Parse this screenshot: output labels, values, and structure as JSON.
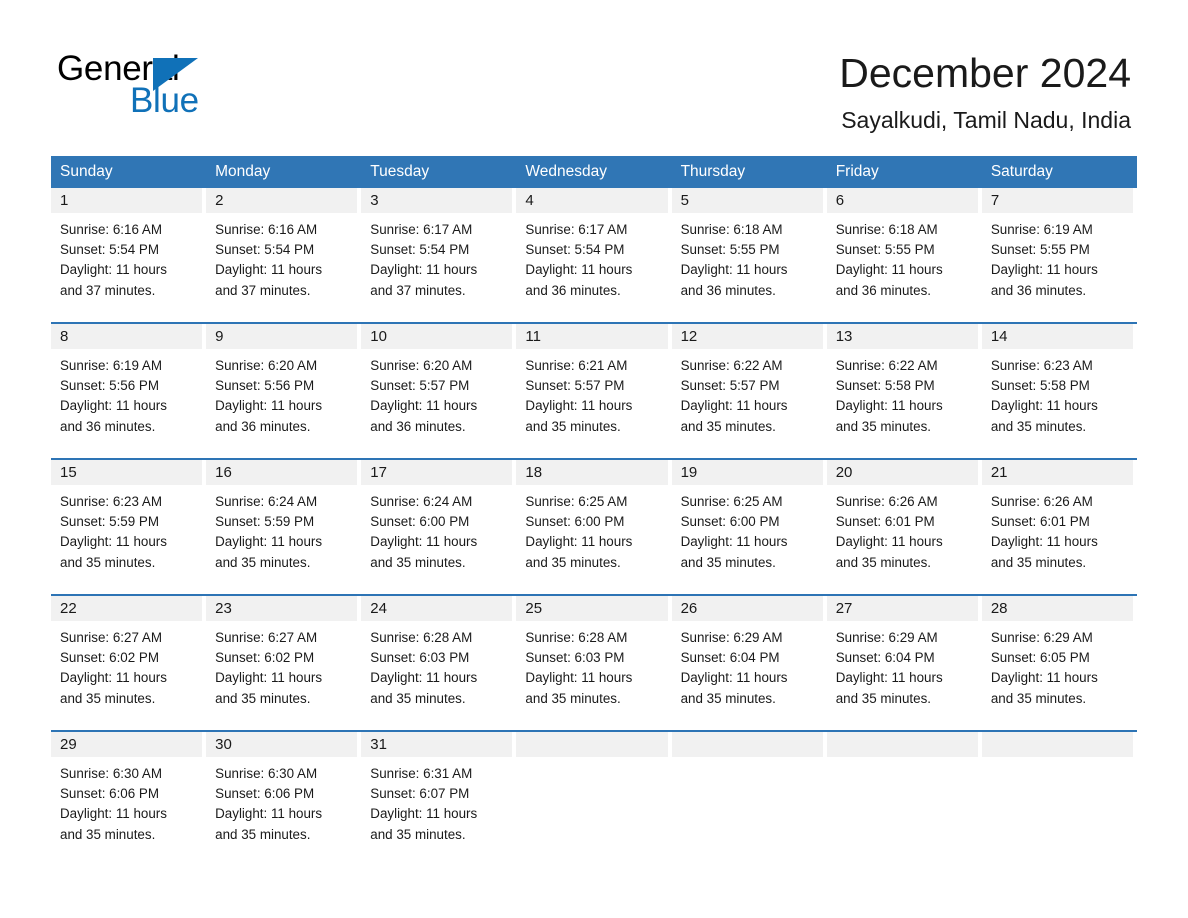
{
  "brand": {
    "name_part1": "General",
    "name_part2": "Blue",
    "triangle_color": "#1071b8",
    "accent_color": "#3076b5"
  },
  "header": {
    "month_title": "December 2024",
    "location": "Sayalkudi, Tamil Nadu, India"
  },
  "calendar": {
    "weekday_headers": [
      "Sunday",
      "Monday",
      "Tuesday",
      "Wednesday",
      "Thursday",
      "Friday",
      "Saturday"
    ],
    "weeks": [
      [
        {
          "day": "1",
          "sunrise": "Sunrise: 6:16 AM",
          "sunset": "Sunset: 5:54 PM",
          "daylight_line1": "Daylight: 11 hours",
          "daylight_line2": "and 37 minutes."
        },
        {
          "day": "2",
          "sunrise": "Sunrise: 6:16 AM",
          "sunset": "Sunset: 5:54 PM",
          "daylight_line1": "Daylight: 11 hours",
          "daylight_line2": "and 37 minutes."
        },
        {
          "day": "3",
          "sunrise": "Sunrise: 6:17 AM",
          "sunset": "Sunset: 5:54 PM",
          "daylight_line1": "Daylight: 11 hours",
          "daylight_line2": "and 37 minutes."
        },
        {
          "day": "4",
          "sunrise": "Sunrise: 6:17 AM",
          "sunset": "Sunset: 5:54 PM",
          "daylight_line1": "Daylight: 11 hours",
          "daylight_line2": "and 36 minutes."
        },
        {
          "day": "5",
          "sunrise": "Sunrise: 6:18 AM",
          "sunset": "Sunset: 5:55 PM",
          "daylight_line1": "Daylight: 11 hours",
          "daylight_line2": "and 36 minutes."
        },
        {
          "day": "6",
          "sunrise": "Sunrise: 6:18 AM",
          "sunset": "Sunset: 5:55 PM",
          "daylight_line1": "Daylight: 11 hours",
          "daylight_line2": "and 36 minutes."
        },
        {
          "day": "7",
          "sunrise": "Sunrise: 6:19 AM",
          "sunset": "Sunset: 5:55 PM",
          "daylight_line1": "Daylight: 11 hours",
          "daylight_line2": "and 36 minutes."
        }
      ],
      [
        {
          "day": "8",
          "sunrise": "Sunrise: 6:19 AM",
          "sunset": "Sunset: 5:56 PM",
          "daylight_line1": "Daylight: 11 hours",
          "daylight_line2": "and 36 minutes."
        },
        {
          "day": "9",
          "sunrise": "Sunrise: 6:20 AM",
          "sunset": "Sunset: 5:56 PM",
          "daylight_line1": "Daylight: 11 hours",
          "daylight_line2": "and 36 minutes."
        },
        {
          "day": "10",
          "sunrise": "Sunrise: 6:20 AM",
          "sunset": "Sunset: 5:57 PM",
          "daylight_line1": "Daylight: 11 hours",
          "daylight_line2": "and 36 minutes."
        },
        {
          "day": "11",
          "sunrise": "Sunrise: 6:21 AM",
          "sunset": "Sunset: 5:57 PM",
          "daylight_line1": "Daylight: 11 hours",
          "daylight_line2": "and 35 minutes."
        },
        {
          "day": "12",
          "sunrise": "Sunrise: 6:22 AM",
          "sunset": "Sunset: 5:57 PM",
          "daylight_line1": "Daylight: 11 hours",
          "daylight_line2": "and 35 minutes."
        },
        {
          "day": "13",
          "sunrise": "Sunrise: 6:22 AM",
          "sunset": "Sunset: 5:58 PM",
          "daylight_line1": "Daylight: 11 hours",
          "daylight_line2": "and 35 minutes."
        },
        {
          "day": "14",
          "sunrise": "Sunrise: 6:23 AM",
          "sunset": "Sunset: 5:58 PM",
          "daylight_line1": "Daylight: 11 hours",
          "daylight_line2": "and 35 minutes."
        }
      ],
      [
        {
          "day": "15",
          "sunrise": "Sunrise: 6:23 AM",
          "sunset": "Sunset: 5:59 PM",
          "daylight_line1": "Daylight: 11 hours",
          "daylight_line2": "and 35 minutes."
        },
        {
          "day": "16",
          "sunrise": "Sunrise: 6:24 AM",
          "sunset": "Sunset: 5:59 PM",
          "daylight_line1": "Daylight: 11 hours",
          "daylight_line2": "and 35 minutes."
        },
        {
          "day": "17",
          "sunrise": "Sunrise: 6:24 AM",
          "sunset": "Sunset: 6:00 PM",
          "daylight_line1": "Daylight: 11 hours",
          "daylight_line2": "and 35 minutes."
        },
        {
          "day": "18",
          "sunrise": "Sunrise: 6:25 AM",
          "sunset": "Sunset: 6:00 PM",
          "daylight_line1": "Daylight: 11 hours",
          "daylight_line2": "and 35 minutes."
        },
        {
          "day": "19",
          "sunrise": "Sunrise: 6:25 AM",
          "sunset": "Sunset: 6:00 PM",
          "daylight_line1": "Daylight: 11 hours",
          "daylight_line2": "and 35 minutes."
        },
        {
          "day": "20",
          "sunrise": "Sunrise: 6:26 AM",
          "sunset": "Sunset: 6:01 PM",
          "daylight_line1": "Daylight: 11 hours",
          "daylight_line2": "and 35 minutes."
        },
        {
          "day": "21",
          "sunrise": "Sunrise: 6:26 AM",
          "sunset": "Sunset: 6:01 PM",
          "daylight_line1": "Daylight: 11 hours",
          "daylight_line2": "and 35 minutes."
        }
      ],
      [
        {
          "day": "22",
          "sunrise": "Sunrise: 6:27 AM",
          "sunset": "Sunset: 6:02 PM",
          "daylight_line1": "Daylight: 11 hours",
          "daylight_line2": "and 35 minutes."
        },
        {
          "day": "23",
          "sunrise": "Sunrise: 6:27 AM",
          "sunset": "Sunset: 6:02 PM",
          "daylight_line1": "Daylight: 11 hours",
          "daylight_line2": "and 35 minutes."
        },
        {
          "day": "24",
          "sunrise": "Sunrise: 6:28 AM",
          "sunset": "Sunset: 6:03 PM",
          "daylight_line1": "Daylight: 11 hours",
          "daylight_line2": "and 35 minutes."
        },
        {
          "day": "25",
          "sunrise": "Sunrise: 6:28 AM",
          "sunset": "Sunset: 6:03 PM",
          "daylight_line1": "Daylight: 11 hours",
          "daylight_line2": "and 35 minutes."
        },
        {
          "day": "26",
          "sunrise": "Sunrise: 6:29 AM",
          "sunset": "Sunset: 6:04 PM",
          "daylight_line1": "Daylight: 11 hours",
          "daylight_line2": "and 35 minutes."
        },
        {
          "day": "27",
          "sunrise": "Sunrise: 6:29 AM",
          "sunset": "Sunset: 6:04 PM",
          "daylight_line1": "Daylight: 11 hours",
          "daylight_line2": "and 35 minutes."
        },
        {
          "day": "28",
          "sunrise": "Sunrise: 6:29 AM",
          "sunset": "Sunset: 6:05 PM",
          "daylight_line1": "Daylight: 11 hours",
          "daylight_line2": "and 35 minutes."
        }
      ],
      [
        {
          "day": "29",
          "sunrise": "Sunrise: 6:30 AM",
          "sunset": "Sunset: 6:06 PM",
          "daylight_line1": "Daylight: 11 hours",
          "daylight_line2": "and 35 minutes."
        },
        {
          "day": "30",
          "sunrise": "Sunrise: 6:30 AM",
          "sunset": "Sunset: 6:06 PM",
          "daylight_line1": "Daylight: 11 hours",
          "daylight_line2": "and 35 minutes."
        },
        {
          "day": "31",
          "sunrise": "Sunrise: 6:31 AM",
          "sunset": "Sunset: 6:07 PM",
          "daylight_line1": "Daylight: 11 hours",
          "daylight_line2": "and 35 minutes."
        },
        {
          "day": "",
          "sunrise": "",
          "sunset": "",
          "daylight_line1": "",
          "daylight_line2": ""
        },
        {
          "day": "",
          "sunrise": "",
          "sunset": "",
          "daylight_line1": "",
          "daylight_line2": ""
        },
        {
          "day": "",
          "sunrise": "",
          "sunset": "",
          "daylight_line1": "",
          "daylight_line2": ""
        },
        {
          "day": "",
          "sunrise": "",
          "sunset": "",
          "daylight_line1": "",
          "daylight_line2": ""
        }
      ]
    ]
  }
}
